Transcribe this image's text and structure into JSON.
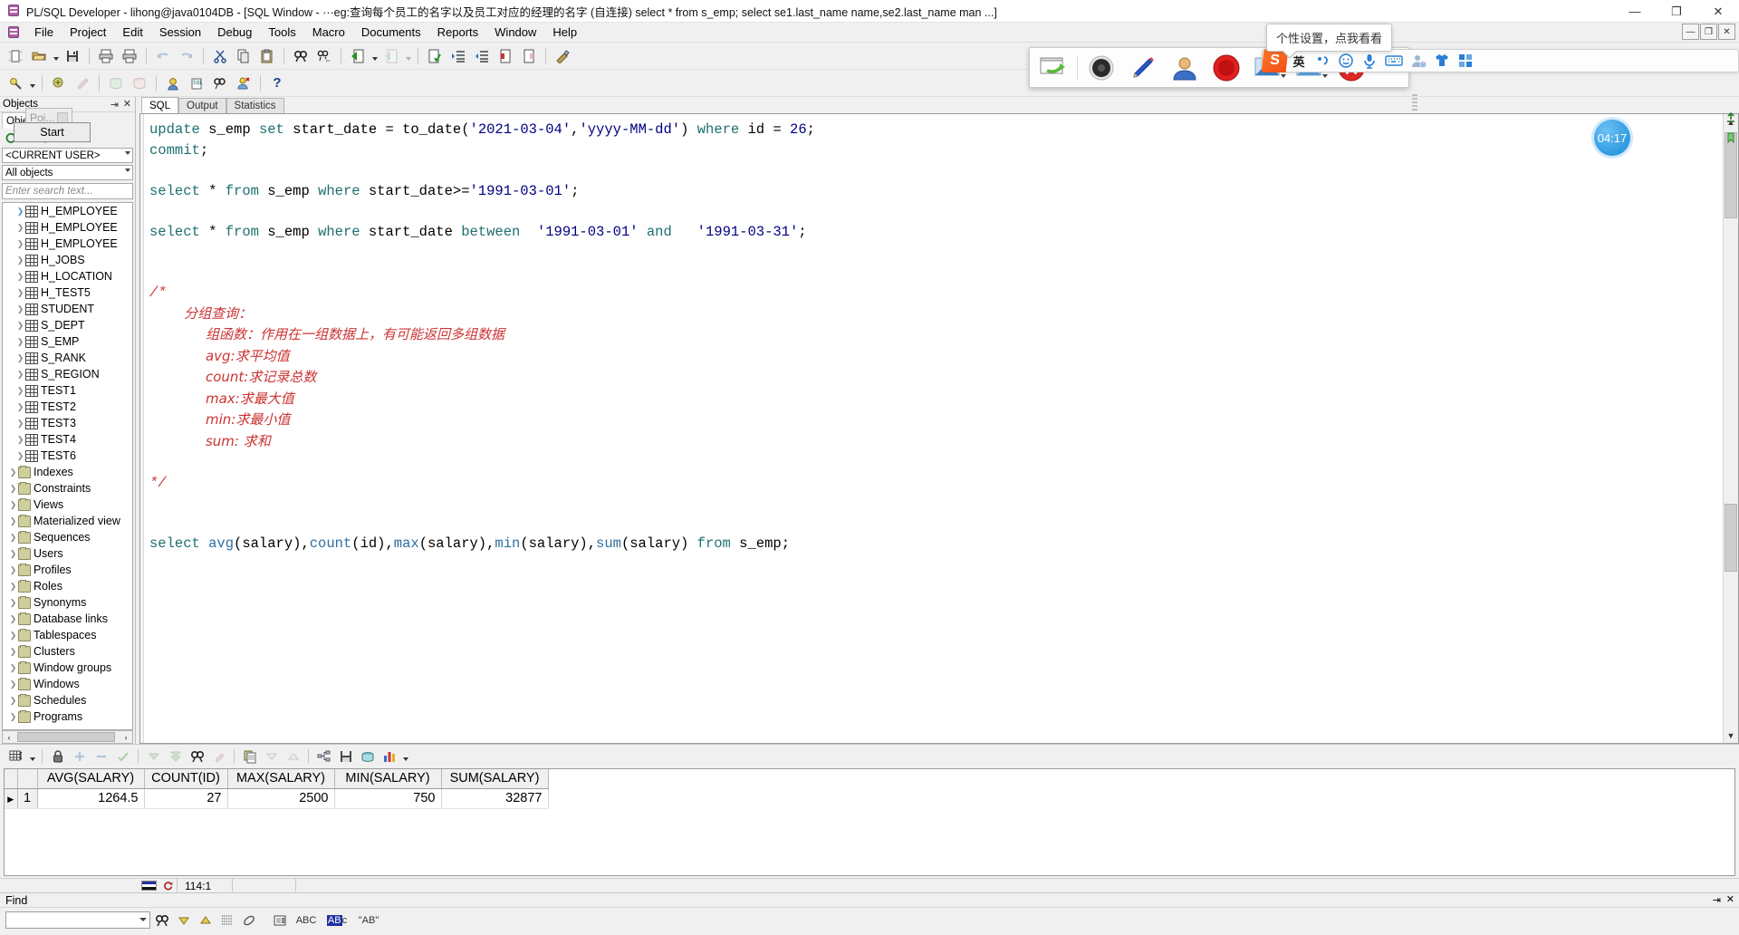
{
  "window": {
    "title": "PL/SQL Developer - lihong@java0104DB - [SQL Window - ···eg:查询每个员工的名字以及员工对应的经理的名字 (自连接)   select * from s_emp; select se1.last_name name,se2.last_name man ...]",
    "app_icon": "plsql-developer-icon",
    "minimize": "—",
    "maximize": "❐",
    "close": "✕",
    "mdi_minimize": "—",
    "mdi_restore": "❐",
    "mdi_close": "✕"
  },
  "menu": {
    "items": [
      "File",
      "Project",
      "Edit",
      "Session",
      "Debug",
      "Tools",
      "Macro",
      "Documents",
      "Reports",
      "Window",
      "Help"
    ]
  },
  "toolbar_main": {
    "icons": [
      "new-icon",
      "open-icon",
      "open-dropdown-caret",
      "save-icon",
      "print-icon",
      "print-preview-icon",
      "undo-icon",
      "redo-icon",
      "cut-icon",
      "copy-icon",
      "paste-icon",
      "find-icon",
      "find-next-icon",
      "execute-icon",
      "execute-dropdown-caret",
      "run-script-icon",
      "run-script-caret",
      "explain-plan-icon",
      "indent-icon",
      "outdent-icon",
      "comment-icon",
      "uncomment-icon",
      "beautifier-icon"
    ]
  },
  "toolbar_secondary": {
    "icons": [
      "sql-window-icon",
      "sql-caret",
      "test-window-icon",
      "command-window-icon",
      "rollback-icon",
      "commit-icon",
      "session-icon",
      "sql-page-icon",
      "find-db-objects-icon",
      "new-user-icon",
      "help-icon"
    ]
  },
  "objects_panel": {
    "header": "Objects",
    "pin": "⇥",
    "close": "✕",
    "tab": "Obje",
    "user_filter": "<CURRENT USER>",
    "object_filter": "All objects",
    "search_placeholder": "Enter search text...",
    "mini_icons": [
      "refresh-icon",
      "add-icon",
      "filter-icon",
      "browse-icon",
      "key-icon"
    ],
    "tooltip": {
      "pointer_label": "Poi...",
      "start_label": "Start"
    },
    "tree": [
      {
        "label": "H_EMPLOYEE",
        "type": "table",
        "indent": 1,
        "selected": true
      },
      {
        "label": "H_EMPLOYEE",
        "type": "table",
        "indent": 1
      },
      {
        "label": "H_EMPLOYEE",
        "type": "table",
        "indent": 1
      },
      {
        "label": "H_JOBS",
        "type": "table",
        "indent": 1
      },
      {
        "label": "H_LOCATION",
        "type": "table",
        "indent": 1
      },
      {
        "label": "H_TEST5",
        "type": "table",
        "indent": 1
      },
      {
        "label": "STUDENT",
        "type": "table",
        "indent": 1
      },
      {
        "label": "S_DEPT",
        "type": "table",
        "indent": 1
      },
      {
        "label": "S_EMP",
        "type": "table",
        "indent": 1
      },
      {
        "label": "S_RANK",
        "type": "table",
        "indent": 1
      },
      {
        "label": "S_REGION",
        "type": "table",
        "indent": 1
      },
      {
        "label": "TEST1",
        "type": "table",
        "indent": 1
      },
      {
        "label": "TEST2",
        "type": "table",
        "indent": 1
      },
      {
        "label": "TEST3",
        "type": "table",
        "indent": 1
      },
      {
        "label": "TEST4",
        "type": "table",
        "indent": 1
      },
      {
        "label": "TEST6",
        "type": "table",
        "indent": 1
      },
      {
        "label": "Indexes",
        "type": "folder",
        "indent": 0
      },
      {
        "label": "Constraints",
        "type": "folder",
        "indent": 0
      },
      {
        "label": "Views",
        "type": "folder",
        "indent": 0
      },
      {
        "label": "Materialized view",
        "type": "folder",
        "indent": 0
      },
      {
        "label": "Sequences",
        "type": "folder",
        "indent": 0
      },
      {
        "label": "Users",
        "type": "folder",
        "indent": 0
      },
      {
        "label": "Profiles",
        "type": "folder",
        "indent": 0
      },
      {
        "label": "Roles",
        "type": "folder",
        "indent": 0
      },
      {
        "label": "Synonyms",
        "type": "folder",
        "indent": 0
      },
      {
        "label": "Database links",
        "type": "folder",
        "indent": 0
      },
      {
        "label": "Tablespaces",
        "type": "folder",
        "indent": 0
      },
      {
        "label": "Clusters",
        "type": "folder",
        "indent": 0
      },
      {
        "label": "Window groups",
        "type": "folder",
        "indent": 0
      },
      {
        "label": "Windows",
        "type": "folder",
        "indent": 0
      },
      {
        "label": "Schedules",
        "type": "folder",
        "indent": 0
      },
      {
        "label": "Programs",
        "type": "folder",
        "indent": 0
      }
    ]
  },
  "editor": {
    "tabs": [
      {
        "label": "SQL",
        "active": true
      },
      {
        "label": "Output",
        "active": false
      },
      {
        "label": "Statistics",
        "active": false
      }
    ],
    "code_lines": [
      [
        {
          "t": "update ",
          "c": "kw"
        },
        {
          "t": "s_emp ",
          "c": "plain"
        },
        {
          "t": "set ",
          "c": "kw"
        },
        {
          "t": "start_date = ",
          "c": "plain"
        },
        {
          "t": "to_date",
          "c": "plain"
        },
        {
          "t": "(",
          "c": "plain"
        },
        {
          "t": "'2021-03-04'",
          "c": "str"
        },
        {
          "t": ",",
          "c": "plain"
        },
        {
          "t": "'yyyy-MM-dd'",
          "c": "str"
        },
        {
          "t": ") ",
          "c": "plain"
        },
        {
          "t": "where ",
          "c": "kw"
        },
        {
          "t": "id = ",
          "c": "plain"
        },
        {
          "t": "26",
          "c": "num"
        },
        {
          "t": ";",
          "c": "plain"
        }
      ],
      [
        {
          "t": "commit",
          "c": "kw"
        },
        {
          "t": ";",
          "c": "plain"
        }
      ],
      [],
      [
        {
          "t": "select ",
          "c": "kw"
        },
        {
          "t": "* ",
          "c": "plain"
        },
        {
          "t": "from ",
          "c": "kw"
        },
        {
          "t": "s_emp ",
          "c": "plain"
        },
        {
          "t": "where ",
          "c": "kw"
        },
        {
          "t": "start_date>=",
          "c": "plain"
        },
        {
          "t": "'1991-03-01'",
          "c": "str"
        },
        {
          "t": ";",
          "c": "plain"
        }
      ],
      [],
      [
        {
          "t": "select ",
          "c": "kw"
        },
        {
          "t": "* ",
          "c": "plain"
        },
        {
          "t": "from ",
          "c": "kw"
        },
        {
          "t": "s_emp ",
          "c": "plain"
        },
        {
          "t": "where ",
          "c": "kw"
        },
        {
          "t": "start_date ",
          "c": "plain"
        },
        {
          "t": "between ",
          "c": "kw"
        },
        {
          "t": " '1991-03-01'",
          "c": "str"
        },
        {
          "t": " and ",
          "c": "kw"
        },
        {
          "t": "  '1991-03-31'",
          "c": "str"
        },
        {
          "t": ";",
          "c": "plain"
        }
      ],
      [],
      [],
      [
        {
          "t": "/*",
          "c": "cmt"
        }
      ],
      [
        {
          "t": "        分组查询：",
          "c": "cmt-cn"
        }
      ],
      [
        {
          "t": "             组函数：作用在一组数据上，有可能返回多组数据",
          "c": "cmt-cn"
        }
      ],
      [
        {
          "t": "             avg:求平均值",
          "c": "cmt-cn"
        }
      ],
      [
        {
          "t": "             count:求记录总数",
          "c": "cmt-cn"
        }
      ],
      [
        {
          "t": "             max:求最大值",
          "c": "cmt-cn"
        }
      ],
      [
        {
          "t": "             min:求最小值",
          "c": "cmt-cn"
        }
      ],
      [
        {
          "t": "             sum: 求和",
          "c": "cmt-cn"
        }
      ],
      [],
      [
        {
          "t": "*/",
          "c": "cmt"
        }
      ],
      [],
      [],
      [
        {
          "t": "select ",
          "c": "kw"
        },
        {
          "t": "avg",
          "c": "fn"
        },
        {
          "t": "(salary),",
          "c": "plain"
        },
        {
          "t": "count",
          "c": "fn"
        },
        {
          "t": "(id),",
          "c": "plain"
        },
        {
          "t": "max",
          "c": "fn"
        },
        {
          "t": "(salary),",
          "c": "plain"
        },
        {
          "t": "min",
          "c": "fn"
        },
        {
          "t": "(salary),",
          "c": "plain"
        },
        {
          "t": "sum",
          "c": "fn"
        },
        {
          "t": "(salary) ",
          "c": "plain"
        },
        {
          "t": "from ",
          "c": "kw"
        },
        {
          "t": "s_emp",
          "c": "plain"
        },
        {
          "t": ";",
          "c": "plain"
        }
      ]
    ],
    "timer_badge": "04:17"
  },
  "grid_toolbar": {
    "icons": [
      "grid-layout-icon",
      "grid-layout-caret",
      "lock-icon",
      "add-row-icon",
      "delete-row-icon",
      "post-changes-icon",
      "next-set-icon",
      "last-set-icon",
      "find-icon",
      "clear-icon",
      "copy-grid-icon",
      "sort-desc-icon",
      "sort-asc-icon",
      "grid-links-icon",
      "export-save-icon",
      "export-db-icon",
      "chart-icon",
      "chart-caret"
    ]
  },
  "results": {
    "columns": [
      "AVG(SALARY)",
      "COUNT(ID)",
      "MAX(SALARY)",
      "MIN(SALARY)",
      "SUM(SALARY)"
    ],
    "rows": [
      {
        "n": "1",
        "values": [
          "1264.5",
          "27",
          "2500",
          "750",
          "32877"
        ]
      }
    ]
  },
  "statusbar": {
    "position": "114:1",
    "icons": [
      "connection-flag-icon",
      "refresh-status-icon"
    ]
  },
  "find_panel": {
    "title": "Find",
    "pin": "⇥",
    "close": "✕",
    "input_value": "",
    "buttons": [
      "find-icon",
      "find-down-icon",
      "find-up-icon",
      "find-list-icon",
      "highlight-icon",
      "find-dialog-icon",
      "match-case-icon",
      "match-word-icon",
      "regex-icon"
    ],
    "labels": {
      "match_case": "ABC",
      "match_word": "AB",
      "regex": "\"AB\""
    }
  },
  "recorder_toolbar": {
    "buttons": [
      {
        "name": "restore-window-icon"
      },
      {
        "name": "record-toggle-icon"
      },
      {
        "name": "pen-annotate-icon"
      },
      {
        "name": "webcam-icon"
      },
      {
        "name": "record-start-icon"
      },
      {
        "name": "screen-capture-icon"
      },
      {
        "name": "screen-region-icon"
      },
      {
        "name": "stop-close-icon"
      }
    ]
  },
  "ime": {
    "tooltip": "个性设置，点我看看",
    "logo": "S",
    "mode": "英",
    "buttons": [
      "punctuation-icon",
      "emoji-icon",
      "voice-input-icon",
      "soft-keyboard-icon",
      "user-icon",
      "skin-icon",
      "toolbox-icon"
    ]
  },
  "colors": {
    "accent": "#2f9be0",
    "comment": "#cc3333",
    "keyword": "#1f6f6f",
    "string": "#000080",
    "ime_orange": "#f04e16"
  }
}
